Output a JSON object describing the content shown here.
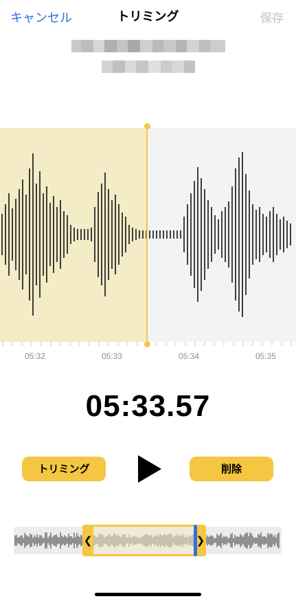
{
  "nav": {
    "cancel_label": "キャンセル",
    "title": "トリミング",
    "save_label": "保存",
    "accent_color": "#2f6fe0"
  },
  "recording": {
    "name_visible": false
  },
  "waveform": {
    "selected_fill": "#f4ebc7",
    "unselected_fill": "#f3f3f3",
    "playhead_color": "#f2c64a"
  },
  "ruler": {
    "labels": [
      "05:32",
      "05:33",
      "05:34",
      "05:35"
    ]
  },
  "playback": {
    "current_time": "05:33.57"
  },
  "actions": {
    "trim_label": "トリミング",
    "delete_label": "削除",
    "button_color": "#f4c641"
  },
  "icons": {
    "play": "play-icon",
    "left_handle": "chevron-left-icon",
    "right_handle": "chevron-right-icon"
  },
  "scrubber": {
    "left_handle_glyph": "❮",
    "right_handle_glyph": "❯"
  }
}
